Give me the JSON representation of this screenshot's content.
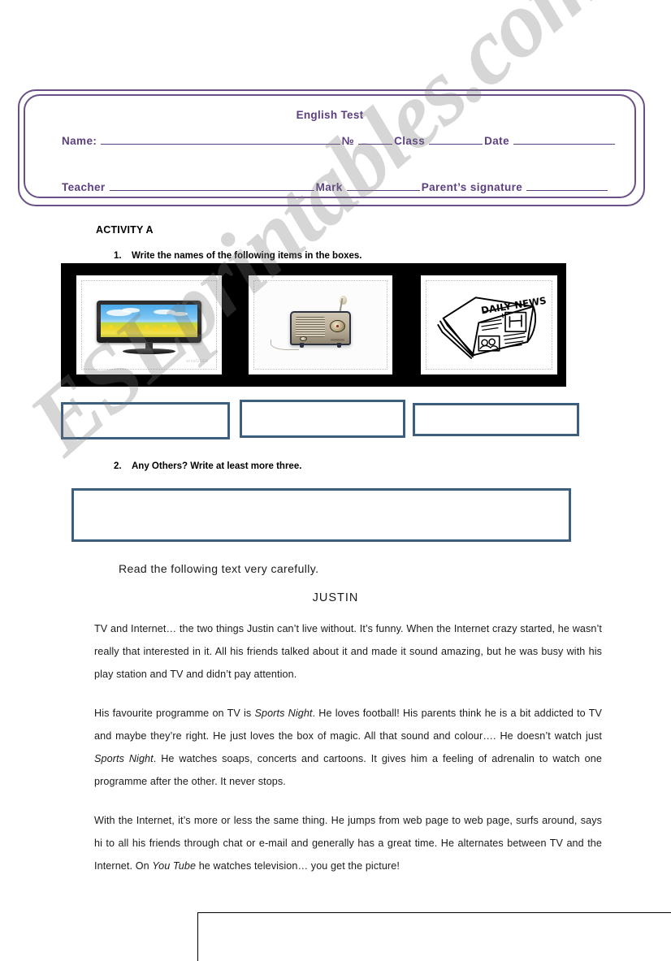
{
  "watermark": {
    "text": "ESLprintables.com"
  },
  "header": {
    "title": "English Test",
    "row1": {
      "name_label": "Name:",
      "number_label": "№",
      "class_label": "Class",
      "date_label": "Date"
    },
    "row2": {
      "teacher_label": "Teacher",
      "mark_label": "Mark",
      "signature_label": "Parent’s signature"
    }
  },
  "activity": {
    "title": "ACTIVITY A",
    "task1": {
      "number": "1.",
      "text": "Write the names of the following items in the boxes."
    },
    "task2": {
      "number": "2.",
      "text": "Any Others? Write at least more three."
    }
  },
  "pictures": [
    {
      "name": "television",
      "credit": "wiseGEEK"
    },
    {
      "name": "radio",
      "credit": ""
    },
    {
      "name": "newspaper",
      "headline": "DAILY NEWS"
    }
  ],
  "answers": {
    "box1_value": "",
    "box2_value": "",
    "box3_value": "",
    "others_value": ""
  },
  "reading": {
    "instruction": "Read the following text very carefully.",
    "title": "JUSTIN",
    "paragraphs": [
      {
        "segments": [
          {
            "type": "plain",
            "text": "TV and Internet… the two things Justin can’t live without. It’s funny. When the Internet crazy started, he wasn’t really that interested in it. All his friends talked about it and made it sound amazing, but he was busy with his play station and TV and didn’t pay attention."
          }
        ]
      },
      {
        "segments": [
          {
            "type": "plain",
            "text": "His favourite programme on TV is "
          },
          {
            "type": "italic",
            "text": "Sports Night"
          },
          {
            "type": "plain",
            "text": ". He loves football! His parents think he is a bit addicted to TV and maybe they’re right. He just loves the box of magic. All that sound and colour…. He doesn’t watch just "
          },
          {
            "type": "italic",
            "text": "Sports Night"
          },
          {
            "type": "plain",
            "text": ". He watches soaps, concerts and cartoons. It gives him a feeling of adrenalin to watch one programme after the other. It never stops."
          }
        ]
      },
      {
        "segments": [
          {
            "type": "plain",
            "text": "With the Internet, it’s more or less the same thing. He jumps from web page to web page, surfs around, says hi to all his friends through chat or e-mail and generally has a great time. He alternates between TV and the Internet. On "
          },
          {
            "type": "italic",
            "text": "You Tube"
          },
          {
            "type": "plain",
            "text": " he watches television… you get the picture!"
          }
        ]
      }
    ]
  },
  "colors": {
    "header_purple": "#5c3f80",
    "answer_border_blue": "#3c5f80",
    "strip_black": "#000000",
    "watermark_gray": "#787878"
  }
}
